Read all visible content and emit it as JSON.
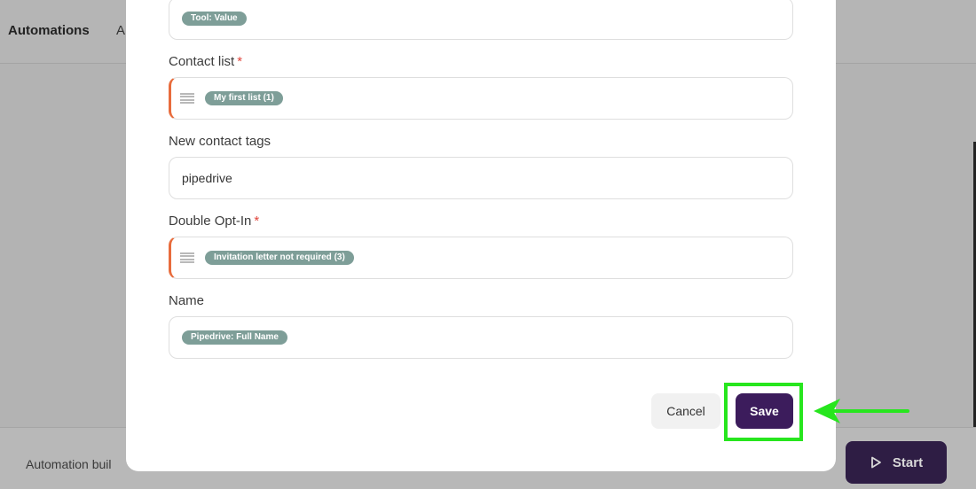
{
  "app": {
    "title": "Automations",
    "title_partial": "A",
    "breadcrumb": "Automation buil",
    "start_label": "Start"
  },
  "modal": {
    "fields": [
      {
        "label": "",
        "required": false,
        "chip_head": "Tool:",
        "chip_rest": " Value"
      },
      {
        "label": "Contact list",
        "required": true,
        "chip": "My first list (1)"
      },
      {
        "label": "New contact tags",
        "required": false,
        "value": "pipedrive"
      },
      {
        "label": "Double Opt-In",
        "required": true,
        "chip": "Invitation letter not required (3)"
      },
      {
        "label": "Name",
        "required": false,
        "chip_head": "Pipedrive:",
        "chip_rest": " Full Name"
      }
    ],
    "required_mark": "*",
    "cancel_label": "Cancel",
    "save_label": "Save"
  },
  "colors": {
    "accent_border": "#e86c3c",
    "chip": "#7e9e98",
    "save": "#3c1c5c",
    "highlight": "#27e61e"
  },
  "icons": [
    "list-icon",
    "play-icon",
    "arrow-icon"
  ]
}
